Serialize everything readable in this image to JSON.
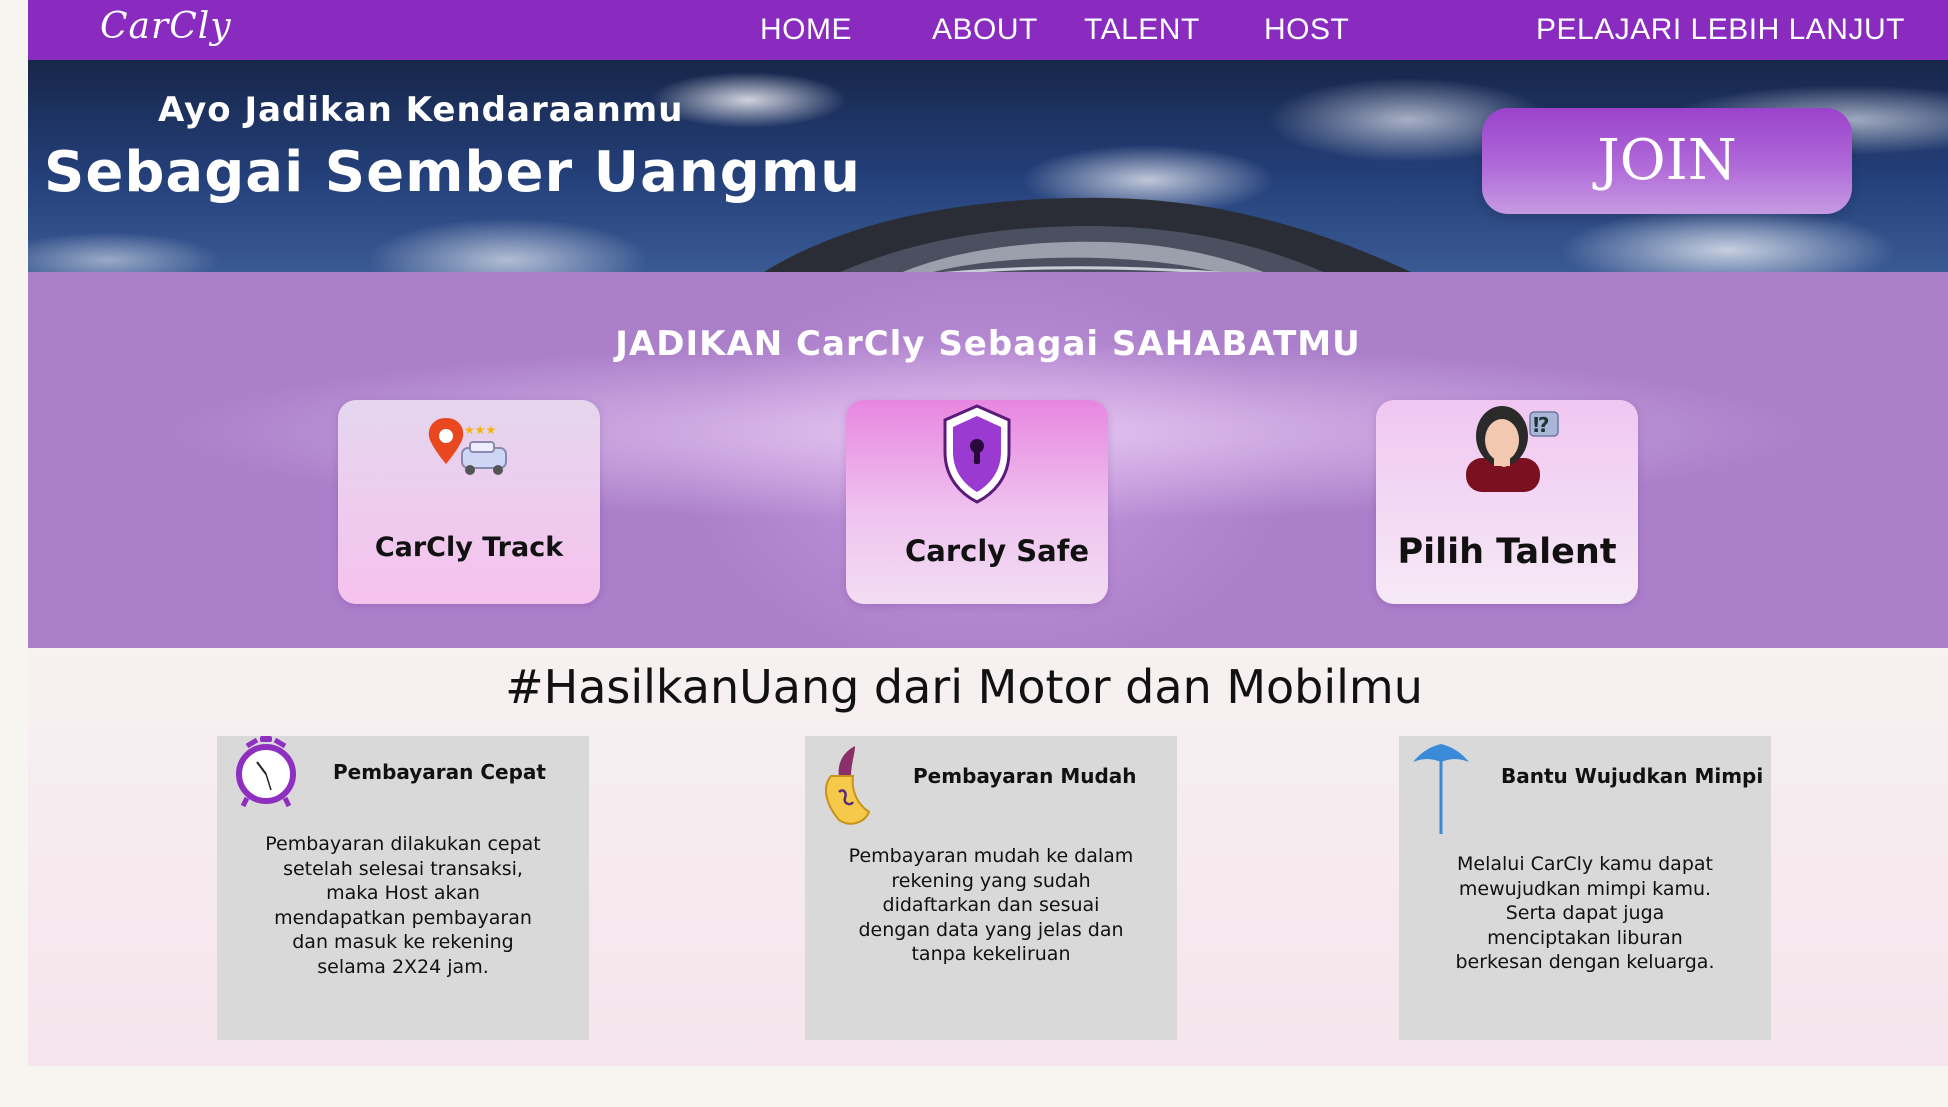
{
  "nav": {
    "logo": "CarCly",
    "links": [
      "HOME",
      "ABOUT",
      "TALENT",
      "HOST"
    ],
    "cta": "PELAJARI LEBIH LANJUT"
  },
  "hero": {
    "subtitle": "Ayo Jadikan Kendaraanmu",
    "title": "Sebagai Sember Uangmu",
    "join": "JOIN"
  },
  "features": {
    "title": "JADIKAN CarCly Sebagai SAHABATMU",
    "cards": [
      {
        "label": "CarCly Track",
        "icon": "location-car-icon"
      },
      {
        "label": "Carcly Safe",
        "icon": "shield-lock-icon"
      },
      {
        "label": "Pilih Talent",
        "icon": "person-question-icon"
      }
    ],
    "talent_badge": "⁉"
  },
  "earn": {
    "title": "#HasilkanUang dari Motor dan Mobilmu",
    "items": [
      {
        "heading": "Pembayaran Cepat",
        "icon": "alarm-clock-icon",
        "lines": [
          "Pembayaran dilakukan cepat",
          "setelah selesai transaksi,",
          "maka Host akan",
          "mendapatkan pembayaran",
          "dan masuk ke rekening",
          "selama 2X24 jam."
        ]
      },
      {
        "heading": "Pembayaran Mudah",
        "icon": "money-icon",
        "lines": [
          "Pembayaran mudah ke dalam",
          "rekening yang sudah",
          "didaftarkan dan sesuai",
          "dengan data yang jelas dan",
          "tanpa kekeliruan"
        ]
      },
      {
        "heading": "Bantu Wujudkan Mimpi",
        "icon": "umbrella-icon",
        "lines": [
          "Melalui CarCly kamu dapat",
          "mewujudkan mimpi kamu.",
          "Serta dapat juga",
          "menciptakan liburan",
          "berkesan dengan keluarga."
        ]
      }
    ]
  },
  "colors": {
    "nav": "#8a2bbf",
    "band": "#ab7fca",
    "card_gray": "#d9d9d9"
  }
}
